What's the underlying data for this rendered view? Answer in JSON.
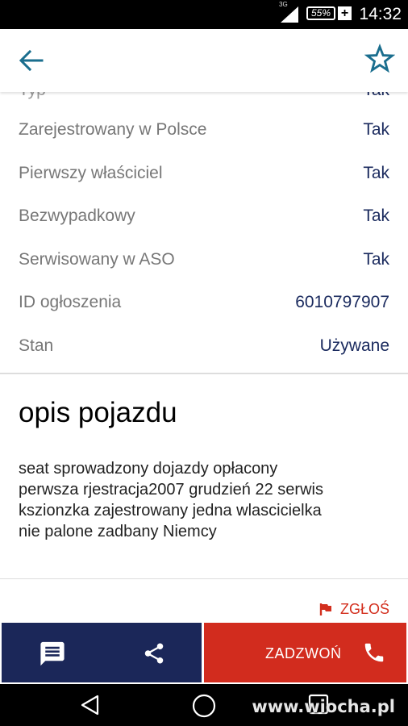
{
  "status_bar": {
    "network": "3G",
    "battery": "55%",
    "charging": "+",
    "time": "14:32"
  },
  "app_bar": {
    "back_icon": "arrow-back-icon",
    "favorite_icon": "star-outline-icon"
  },
  "details": [
    {
      "label": "Zarejestrowany w Polsce",
      "value": "Tak"
    },
    {
      "label": "Pierwszy właściciel",
      "value": "Tak"
    },
    {
      "label": "Bezwypadkowy",
      "value": "Tak"
    },
    {
      "label": "Serwisowany w ASO",
      "value": "Tak"
    },
    {
      "label": "ID ogłoszenia",
      "value": "6010797907"
    },
    {
      "label": "Stan",
      "value": "Używane"
    }
  ],
  "description": {
    "heading": "opis pojazdu",
    "lines": [
      "seat sprowadzony dojazdy opłacony",
      "perwsza rjestracja2007 grudzień 22 serwis",
      "kszionzka zajestrowany jedna wlascicielka",
      "nie palone zadbany Niemcy"
    ]
  },
  "report_label": "ZGŁOŚ",
  "bottom_bar": {
    "message_icon": "message-icon",
    "share_icon": "share-icon",
    "call_label": "ZADZWOŃ",
    "call_icon": "phone-icon"
  },
  "watermark": "www.wiocha.pl",
  "colors": {
    "accent_teal": "#1a6e8e",
    "navy": "#1b2759",
    "red": "#d22c1e"
  }
}
